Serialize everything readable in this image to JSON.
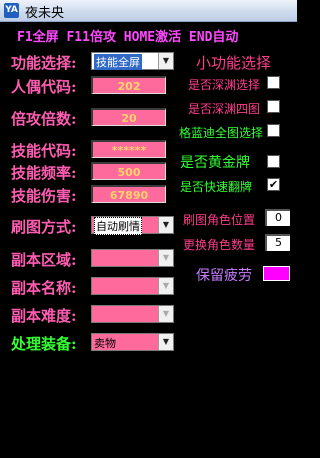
{
  "window": {
    "icon": "app-icon",
    "title": "夜未央"
  },
  "hotkeys": "F1全屏 F11倍攻 HOME激活 END自动",
  "left": {
    "function_label": "功能选择:",
    "function_value": "技能全屏",
    "puppet_code_label": "人偶代码:",
    "puppet_code_value": "202",
    "attack_mult_label": "倍攻倍数:",
    "attack_mult_value": "20",
    "skill_code_label": "技能代码:",
    "skill_code_value": "******",
    "skill_freq_label": "技能频率:",
    "skill_freq_value": "500",
    "skill_dmg_label": "技能伤害:",
    "skill_dmg_value": "67890",
    "brush_mode_label": "刷图方式:",
    "brush_mode_value": "自动刷情",
    "dungeon_area_label": "副本区域:",
    "dungeon_name_label": "副本名称:",
    "dungeon_diff_label": "副本难度:",
    "equip_label": "处理装备:",
    "equip_value": "卖物"
  },
  "right": {
    "heading": "小功能选择",
    "abyss_select": "是否深渊选择",
    "abyss_map": "是否深渊四图",
    "lanlan_select": "格蓝迪全图选择",
    "gold_card": "是否黄金牌",
    "fast_flip": "是否快速翻牌",
    "fast_flip_checked": "✔",
    "char_pos_label": "刷图角色位置",
    "char_pos_value": "0",
    "char_count_label": "更换角色数量",
    "char_count_value": "5",
    "keep_fatigue_label": "保留疲劳",
    "keep_fatigue_color": "#ff00ff"
  },
  "colors": {
    "label": "#ff5db1",
    "field": "#ff6a9c",
    "hotkey": "#ff48ff",
    "green": "#34ff34"
  }
}
